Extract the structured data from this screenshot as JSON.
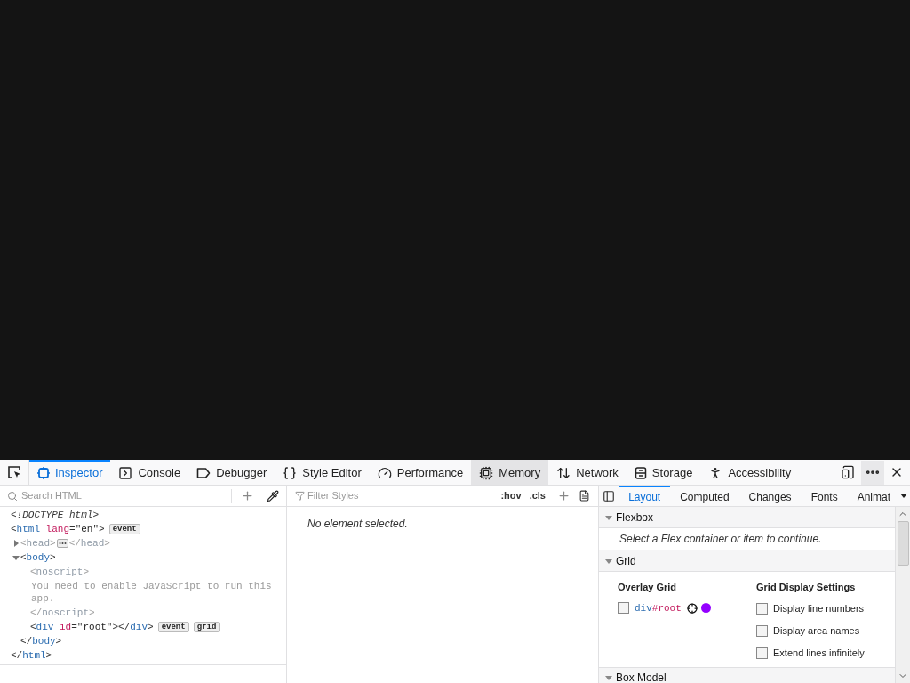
{
  "toolbar": {
    "tabs": [
      {
        "label": "Inspector",
        "selected": true,
        "hovered": false
      },
      {
        "label": "Console",
        "selected": false,
        "hovered": false
      },
      {
        "label": "Debugger",
        "selected": false,
        "hovered": false
      },
      {
        "label": "Style Editor",
        "selected": false,
        "hovered": false
      },
      {
        "label": "Performance",
        "selected": false,
        "hovered": false
      },
      {
        "label": "Memory",
        "selected": false,
        "hovered": true
      },
      {
        "label": "Network",
        "selected": false,
        "hovered": false
      },
      {
        "label": "Storage",
        "selected": false,
        "hovered": false
      },
      {
        "label": "Accessibility",
        "selected": false,
        "hovered": false
      }
    ]
  },
  "markup": {
    "search": {
      "placeholder": "Search HTML"
    },
    "nodes": [
      {
        "kind": "doctype",
        "text": "<!DOCTYPE html>"
      },
      {
        "kind": "element",
        "dimmed": false,
        "open": [
          {
            "kind": "p",
            "t": "<"
          },
          {
            "kind": "tag",
            "t": "html"
          },
          {
            "kind": "attr",
            "t": " lang"
          },
          {
            "kind": "p",
            "t": "=\""
          },
          {
            "kind": "value",
            "t": "en"
          },
          {
            "kind": "p",
            "t": "\">"
          }
        ],
        "badges": [
          "event"
        ],
        "close": [
          {
            "kind": "p",
            "t": "</"
          },
          {
            "kind": "tag",
            "t": "html"
          },
          {
            "kind": "p",
            "t": ">"
          }
        ],
        "children": [
          {
            "kind": "element",
            "dimmed": true,
            "expanded": false,
            "open": [
              {
                "kind": "p",
                "t": "<"
              },
              {
                "kind": "tag",
                "t": "head"
              },
              {
                "kind": "p",
                "t": ">"
              }
            ],
            "close": [
              {
                "kind": "p",
                "t": "</"
              },
              {
                "kind": "tag",
                "t": "head"
              },
              {
                "kind": "p",
                "t": ">"
              }
            ]
          },
          {
            "kind": "element",
            "dimmed": false,
            "expanded": true,
            "open": [
              {
                "kind": "p",
                "t": "<"
              },
              {
                "kind": "tag",
                "t": "body"
              },
              {
                "kind": "p",
                "t": ">"
              }
            ],
            "close": [
              {
                "kind": "p",
                "t": "</"
              },
              {
                "kind": "tag",
                "t": "body"
              },
              {
                "kind": "p",
                "t": ">"
              }
            ],
            "children": [
              {
                "kind": "element",
                "dimmed": true,
                "open": [
                  {
                    "kind": "p",
                    "t": "<"
                  },
                  {
                    "kind": "tag",
                    "t": "noscript"
                  },
                  {
                    "kind": "p",
                    "t": ">"
                  }
                ],
                "close": [
                  {
                    "kind": "p",
                    "t": "</"
                  },
                  {
                    "kind": "tag",
                    "t": "noscript"
                  },
                  {
                    "kind": "p",
                    "t": ">"
                  }
                ],
                "children": [
                  {
                    "kind": "text",
                    "dimmed": true,
                    "text": "You need to enable JavaScript to run this app."
                  }
                ]
              },
              {
                "kind": "element",
                "dimmed": false,
                "open": [
                  {
                    "kind": "p",
                    "t": "<"
                  },
                  {
                    "kind": "tag",
                    "t": "div"
                  },
                  {
                    "kind": "attr",
                    "t": " id"
                  },
                  {
                    "kind": "p",
                    "t": "=\""
                  },
                  {
                    "kind": "value",
                    "t": "root"
                  },
                  {
                    "kind": "p",
                    "t": "\"></"
                  },
                  {
                    "kind": "tag",
                    "t": "div"
                  },
                  {
                    "kind": "p",
                    "t": ">"
                  }
                ],
                "badges": [
                  "event",
                  "grid"
                ]
              }
            ]
          }
        ]
      }
    ]
  },
  "rules": {
    "filter": {
      "placeholder": "Filter Styles"
    },
    "hov": ":hov",
    "cls": ".cls",
    "message": "No element selected."
  },
  "sidebar": {
    "tabs": [
      {
        "label": "Layout",
        "selected": true
      },
      {
        "label": "Computed",
        "selected": false
      },
      {
        "label": "Changes",
        "selected": false
      },
      {
        "label": "Fonts",
        "selected": false
      },
      {
        "label": "Animat",
        "selected": false
      }
    ],
    "sections": [
      {
        "kind": "message",
        "title": "Flexbox",
        "expanded": true,
        "message": "Select a Flex container or item to continue."
      },
      {
        "kind": "grid",
        "title": "Grid",
        "expanded": true,
        "overlay": {
          "heading": "Overlay Grid",
          "items": [
            {
              "tag": "div",
              "id": "#root",
              "checked": false,
              "color": "#9400ff"
            }
          ]
        },
        "settings": {
          "heading": "Grid Display Settings",
          "options": [
            {
              "label": "Display line numbers",
              "checked": false
            },
            {
              "label": "Display area names",
              "checked": false
            },
            {
              "label": "Extend lines infinitely",
              "checked": false
            }
          ]
        }
      },
      {
        "kind": "header",
        "title": "Box Model",
        "expanded": true
      }
    ]
  }
}
